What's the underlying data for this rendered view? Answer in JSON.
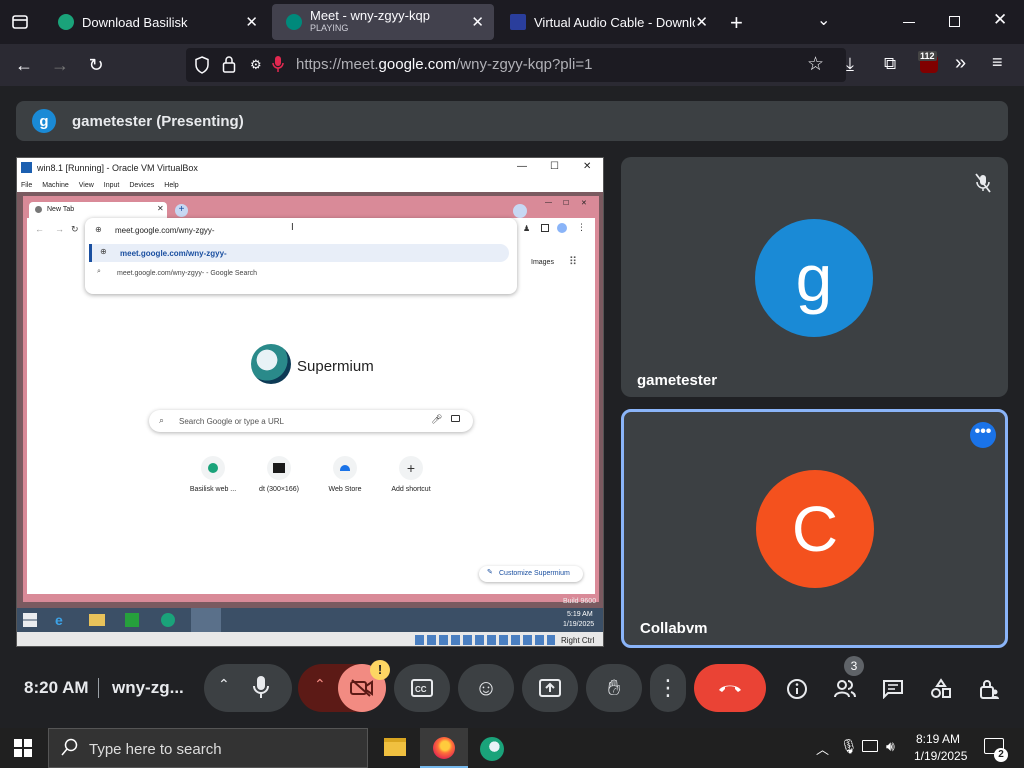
{
  "browser": {
    "tabs": [
      {
        "label": "Download Basilisk",
        "sub": ""
      },
      {
        "label": "Meet - wny-zgyy-kqp",
        "sub": "PLAYING"
      },
      {
        "label": "Virtual Audio Cable - Downloa",
        "sub": ""
      }
    ],
    "url_prefix": "https://meet.",
    "url_domain": "google.com",
    "url_path": "/wny-zgyy-kqp?pli=1",
    "extension_badge": "112"
  },
  "meet": {
    "presenting_initial": "g",
    "presenting_label": "gametester (Presenting)",
    "tiles": [
      {
        "initial": "g",
        "name": "gametester",
        "color": "#1a8ad6"
      },
      {
        "initial": "C",
        "name": "Collabvm",
        "color": "#f4511e"
      }
    ],
    "time": "8:20 AM",
    "meeting_code": "wny-zg...",
    "people_count": "3",
    "camera_warning": "!"
  },
  "vm": {
    "window_title": "win8.1 [Running] - Oracle VM VirtualBox",
    "menu": [
      "File",
      "Machine",
      "View",
      "Input",
      "Devices",
      "Help"
    ],
    "tab_label": "New Tab",
    "address_text": "meet.google.com/wny-zgyy-",
    "suggestion_1": "meet.google.com/wny-zgyy-",
    "suggestion_2": "meet.google.com/wny-zgyy- - Google Search",
    "images_link": "Images",
    "brand": "Supermium",
    "search_placeholder": "Search Google or type a URL",
    "shortcuts": [
      "Basilisk web ...",
      "dt (300×166)",
      "Web Store",
      "Add shortcut"
    ],
    "customize": "Customize Supermium",
    "clock_time": "5:19 AM",
    "clock_date": "1/19/2025",
    "build_text": "Build 9600",
    "host_key": "Right Ctrl"
  },
  "taskbar": {
    "search_placeholder": "Type here to search",
    "time": "8:19 AM",
    "date": "1/19/2025",
    "notification_count": "2"
  },
  "colors": {
    "meet_bg": "#202124",
    "tile_bg": "#3c4043",
    "end_call": "#ea4335",
    "camera_off": "#f28b82",
    "accent_blue": "#8ab4f8"
  }
}
